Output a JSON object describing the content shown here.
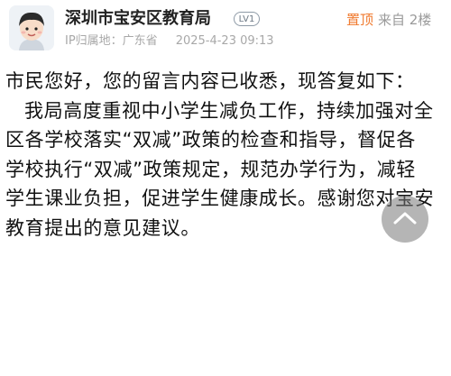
{
  "header": {
    "username": "深圳市宝安区教育局",
    "level": "LV1",
    "pinned": "置顶",
    "floor": "来自 2楼",
    "ip_location": "IP归属地：广东省",
    "timestamp": "2025-4-23 09:13"
  },
  "reply": {
    "paragraph1": "市民您好，您的留言内容已收悉，现答复如下：",
    "paragraph2": "我局高度重视中小学生减负工作，持续加强对全区各学校落实“双减”政策的检查和指导，督促各学校执行“双减”政策规定，规范办学行为，减轻学生课业负担，促进学生健康成长。感谢您对宝安教育提出的意见建议。"
  },
  "colors": {
    "pinned": "#f07a2f",
    "meta": "#a8a8a8",
    "text": "#111111"
  },
  "icons": {
    "avatar": "cartoon-child-avatar",
    "scroll_top": "chevron-up-icon"
  }
}
